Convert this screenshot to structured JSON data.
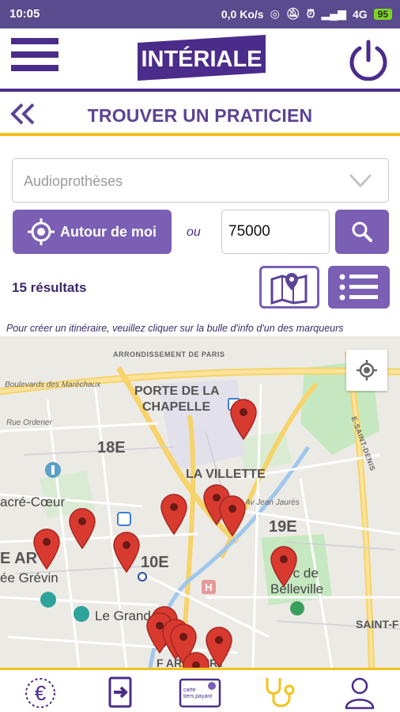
{
  "status_bar": {
    "time": "10:05",
    "network_speed": "0,0 Ko/s",
    "network_type": "4G",
    "battery": "95"
  },
  "header": {
    "logo_text": "INTÉRIALE",
    "title": "TROUVER UN PRATICIEN"
  },
  "search": {
    "specialty_value": "Audioprothèses",
    "around_me_label": "Autour de moi",
    "or_label": "ou",
    "postal_code_value": "75000"
  },
  "results": {
    "count_label": "15 résultats",
    "hint": "Pour créer un itinéraire, veuillez cliquer sur la bulle d'info d'un des marqueurs"
  },
  "map": {
    "labels": {
      "arrondissement": "ARRONDISSEMENT DE PARIS",
      "boulevard": "Boulevards des Maréchaux",
      "porte_line1": "PORTE DE LA",
      "porte_line2": "CHAPELLE",
      "rue_ordener": "Rue Ordener",
      "d18": "18E",
      "villette": "LA VILLETTE",
      "sacre_coeur": "acré-Cœur",
      "av_jean_jaures": "Av Jean Jaurès",
      "d19": "19E",
      "d10": "10E",
      "e_ar": "E AR",
      "grevin": "ée Grévin",
      "parc_line1": "rc de",
      "parc_line2": "Belleville",
      "le_grand": "Le Grand",
      "saint_f": "SAINT-F",
      "faubourg": "F   ARICOURT",
      "saint_denis": "E-SAINT-DENIS"
    },
    "marker_color": "#d93a30"
  },
  "colors": {
    "brand_purple": "#4b2c8a",
    "button_purple": "#7a5fb4",
    "accent_yellow": "#f5c21b"
  },
  "bottom_nav": {
    "card_label_line1": "carte",
    "card_label_line2": "tiers payant"
  }
}
